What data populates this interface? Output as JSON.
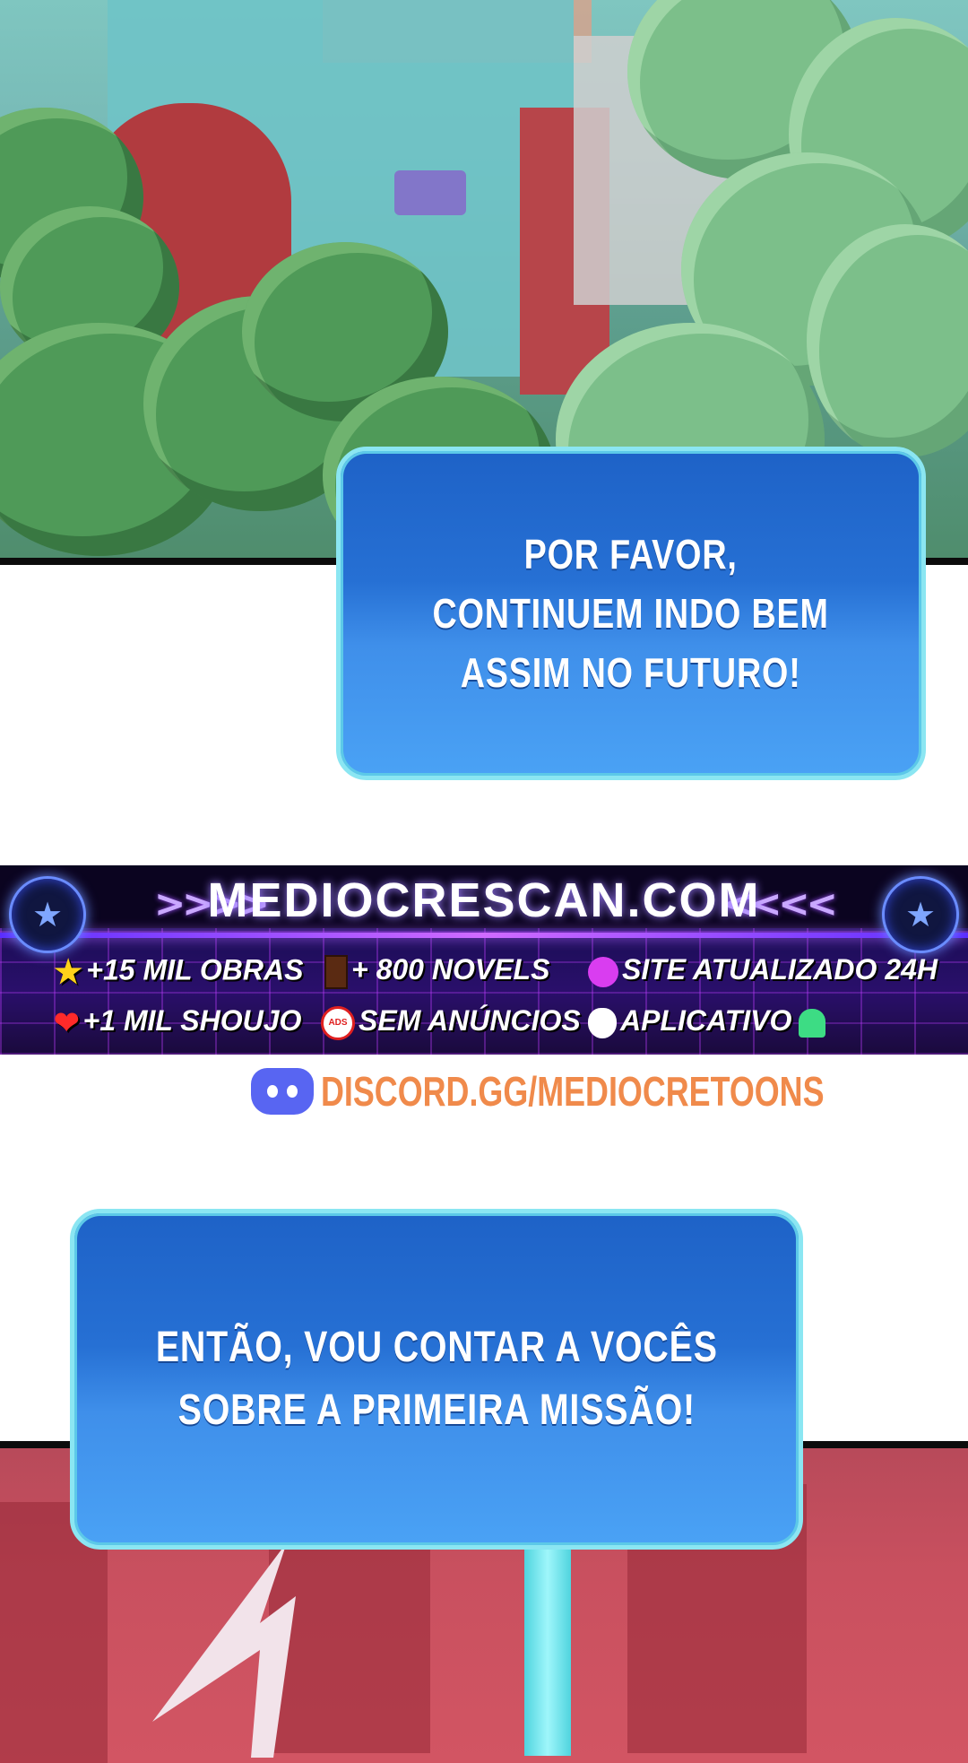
{
  "dialog_top": {
    "text": "POR FAVOR,\nCONTINUEM INDO BEM\nASSIM NO FUTURO!"
  },
  "banner": {
    "site": "MEDIOCRESCAN.COM",
    "arrows_left": ">>>>",
    "arrows_right": "<<<<",
    "features": [
      {
        "icon": "star-icon",
        "label": "+15 MIL OBRAS"
      },
      {
        "icon": "book-icon",
        "label": "+ 800 NOVELS"
      },
      {
        "icon": "clock-icon",
        "label": "SITE ATUALIZADO 24H"
      },
      {
        "icon": "heart-icon",
        "label": "+1 MIL SHOUJO"
      },
      {
        "icon": "no-ads-icon",
        "label": "SEM ANÚNCIOS"
      },
      {
        "icon": "apple-icon",
        "label": "APLICATIVO"
      }
    ],
    "no_ads_badge": "ADS"
  },
  "discord": {
    "text": "DISCORD.GG/MEDIOCRETOONS",
    "color": "#f08a4b"
  },
  "dialog_bottom": {
    "text": "ENTÃO, VOU CONTAR A VOCÊS\nSOBRE A PRIMEIRA MISSÃO!"
  },
  "colors": {
    "bubble": "#2a74d8",
    "bubble_border": "#8be6f2",
    "scene_bottom": "#c9505f"
  }
}
